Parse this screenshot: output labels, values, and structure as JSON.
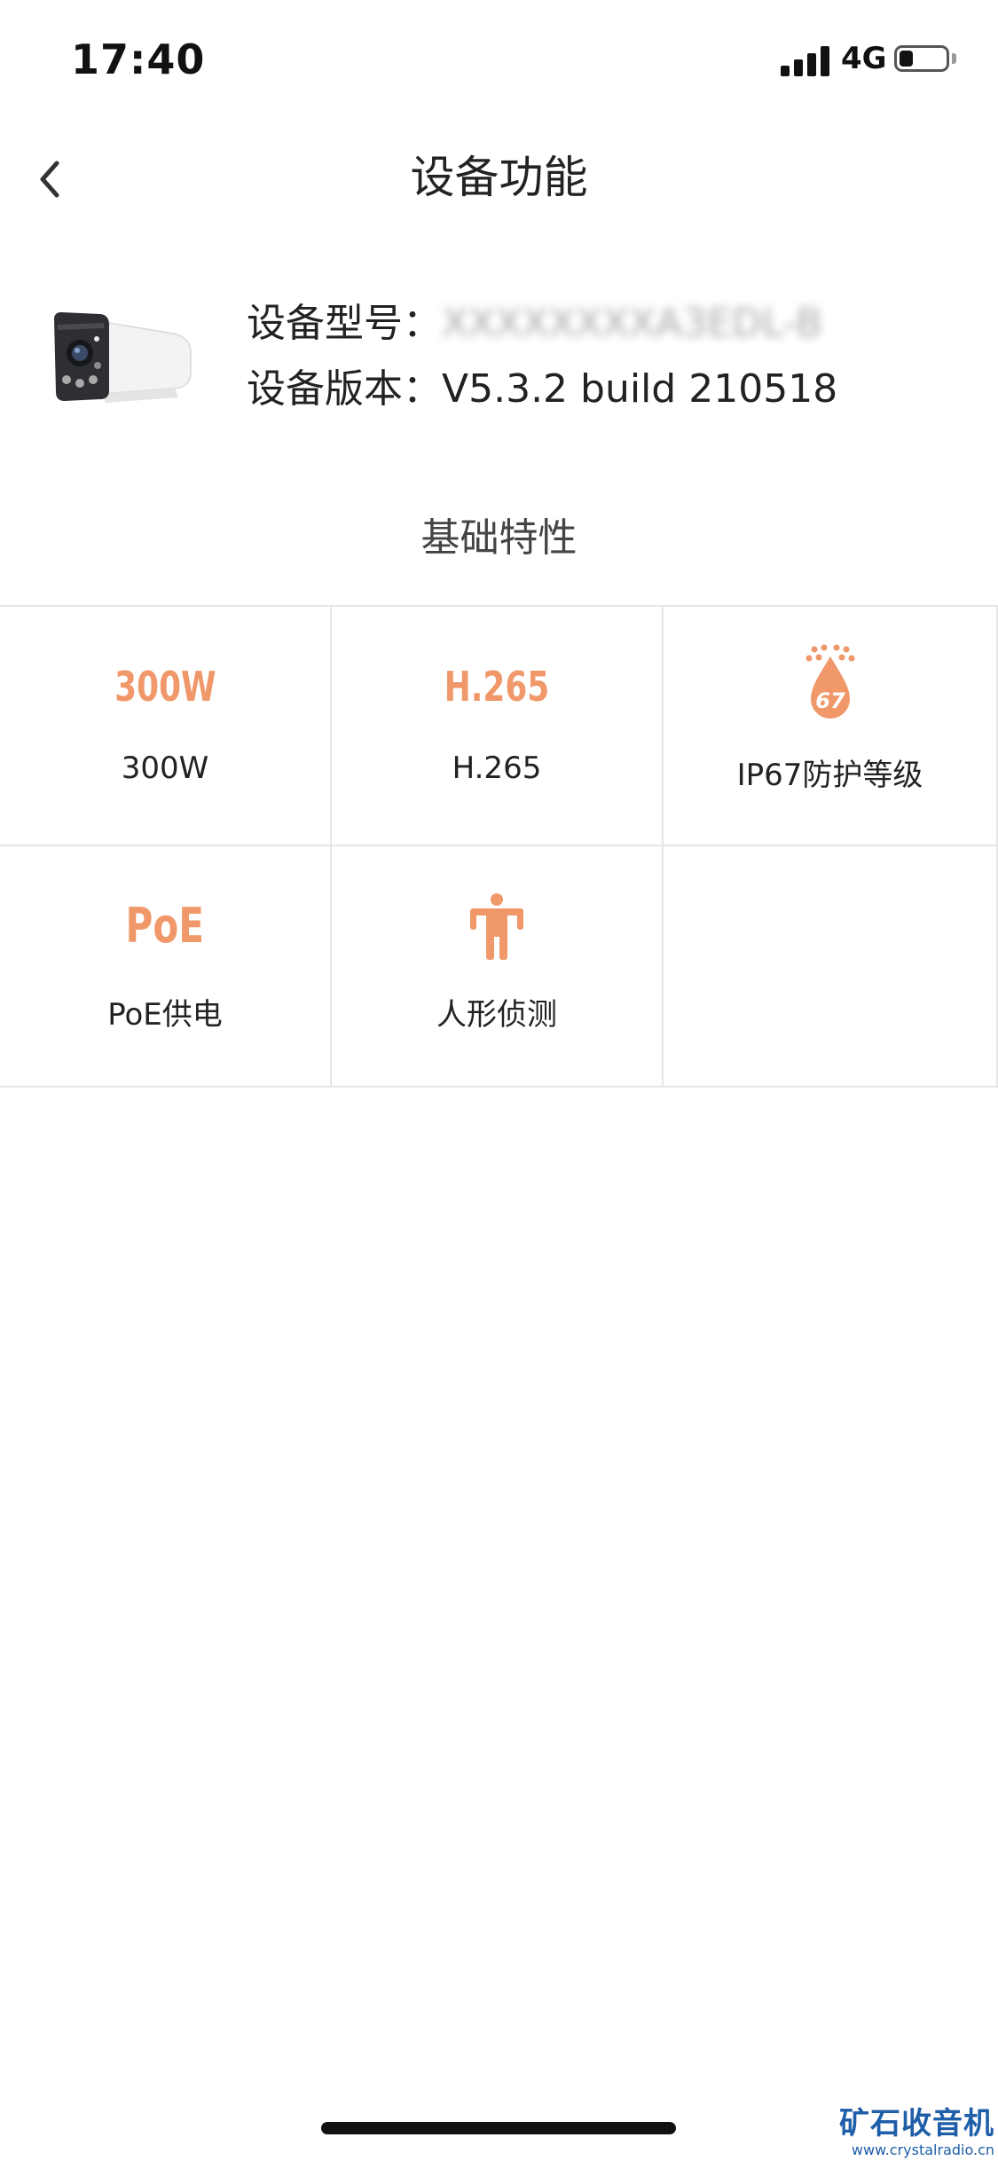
{
  "status_bar": {
    "time": "17:40",
    "network": "4G",
    "battery_level": 0.3
  },
  "header": {
    "title": "设备功能",
    "back_icon": "chevron-left-icon"
  },
  "device": {
    "model_label": "设备型号：",
    "model_value": "XXXXXXXXA3EDL-B",
    "version_label": "设备版本：",
    "version_value": "V5.3.2 build 210518"
  },
  "section": {
    "title": "基础特性"
  },
  "features": [
    {
      "icon": "300w-icon",
      "icon_text": "300W",
      "label": "300W"
    },
    {
      "icon": "h265-icon",
      "icon_text": "H.265",
      "label": "H.265"
    },
    {
      "icon": "ip67-waterdrop-icon",
      "icon_text": "67",
      "label": "IP67防护等级"
    },
    {
      "icon": "poe-icon",
      "icon_text": "PoE",
      "label": "PoE供电"
    },
    {
      "icon": "human-figure-icon",
      "label": "人形侦测"
    }
  ],
  "accent_color": "#f0986a",
  "watermark": {
    "title": "矿石收音机",
    "url": "www.crystalradio.cn"
  }
}
